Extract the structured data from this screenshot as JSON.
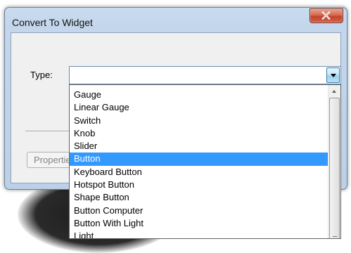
{
  "window": {
    "title": "Convert To Widget",
    "close_icon": "close-x-icon"
  },
  "form": {
    "type_label": "Type:",
    "type_value": "",
    "properties_button": "Properties"
  },
  "dropdown": {
    "items": [
      "Gauge",
      "Linear Gauge",
      "Switch",
      "Knob",
      "Slider",
      "Button",
      "Keyboard Button",
      "Hotspot Button",
      "Shape Button",
      "Button Computer",
      "Button With Light",
      "Light"
    ],
    "selected": "Button"
  },
  "colors": {
    "selection": "#3399ff",
    "close_button": "#c2432a",
    "window_frame": "#c3d6ec"
  }
}
